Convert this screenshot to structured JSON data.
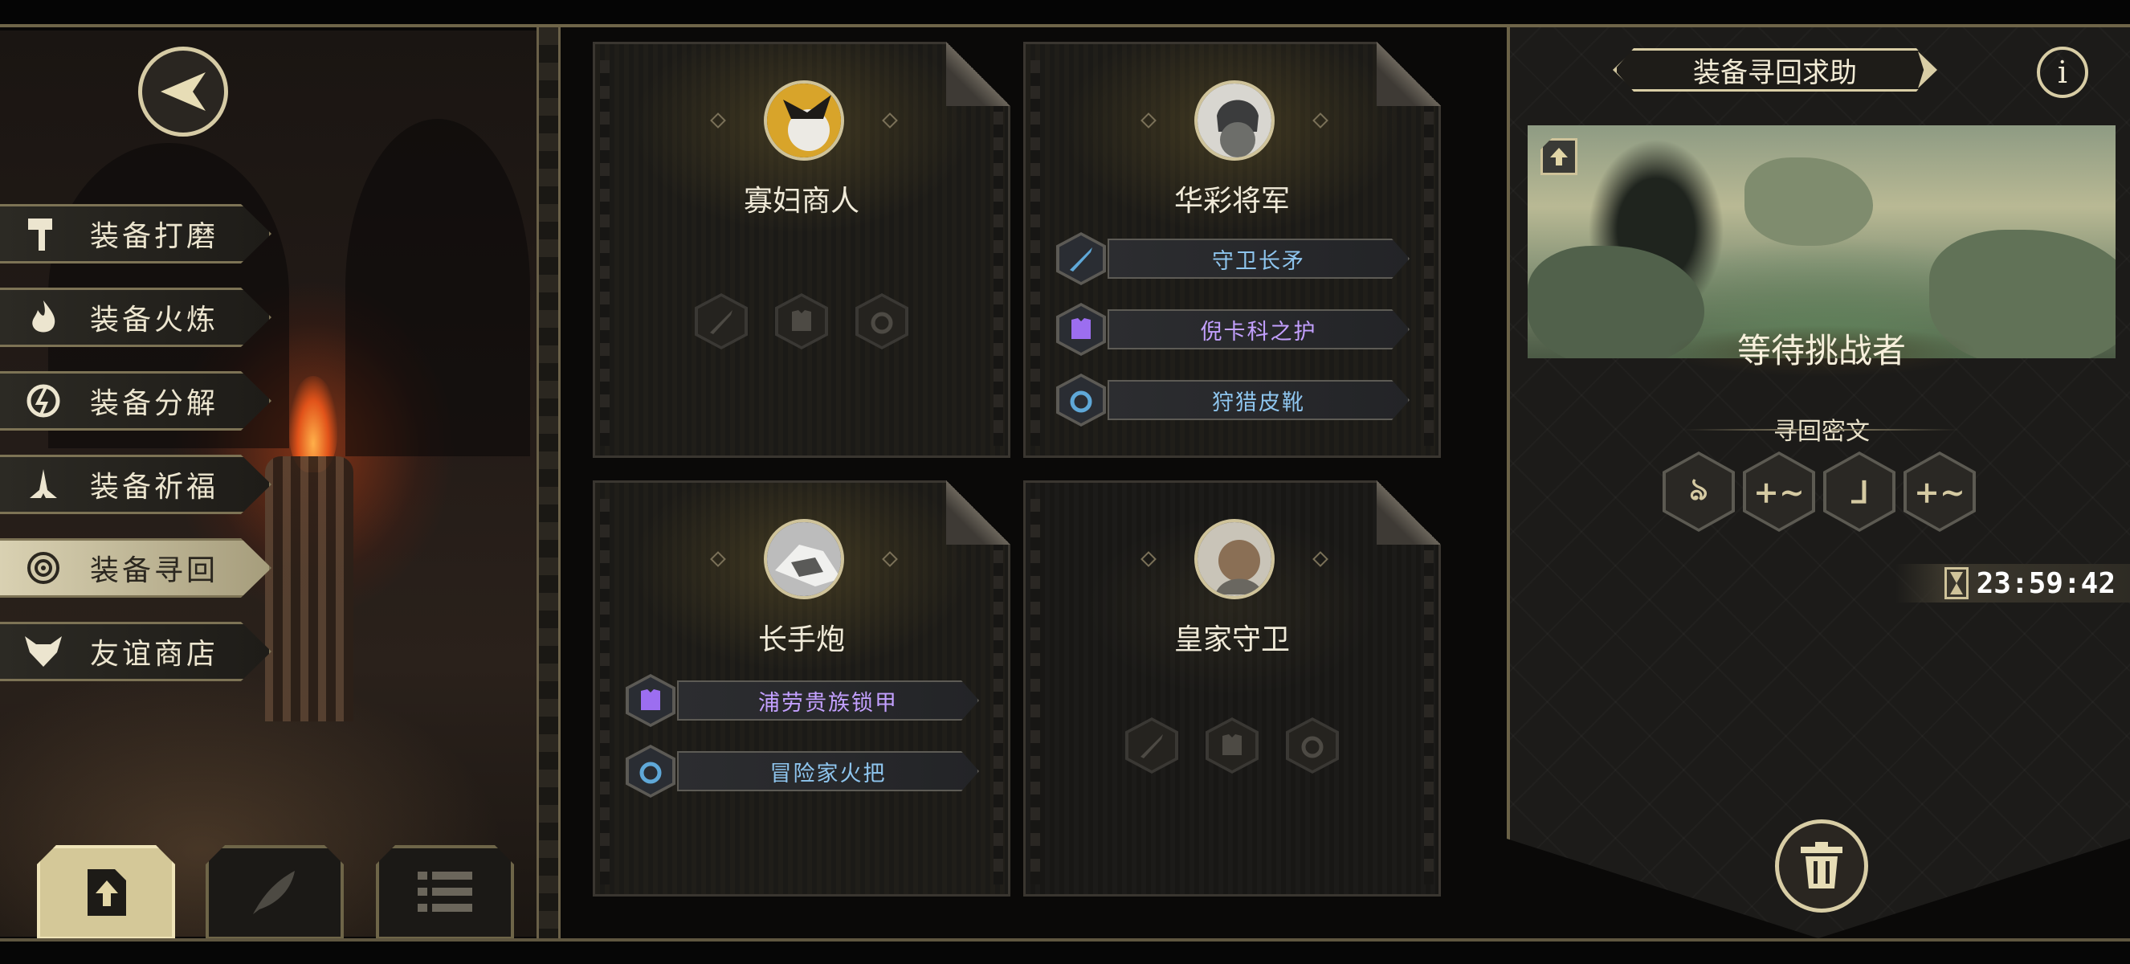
{
  "menu": {
    "items": [
      {
        "label": "装备打磨",
        "icon": "hammer-icon",
        "active": false
      },
      {
        "label": "装备火炼",
        "icon": "flame-icon",
        "active": false
      },
      {
        "label": "装备分解",
        "icon": "disassemble-icon",
        "active": false
      },
      {
        "label": "装备祈福",
        "icon": "pray-hands-icon",
        "active": false
      },
      {
        "label": "装备寻回",
        "icon": "target-icon",
        "active": true
      },
      {
        "label": "友谊商店",
        "icon": "fox-head-icon",
        "active": false
      }
    ]
  },
  "bottom_tabs": [
    {
      "icon": "upload-doc-icon",
      "active": true
    },
    {
      "icon": "feather-icon",
      "active": false
    },
    {
      "icon": "list-icon",
      "active": false
    }
  ],
  "cards": [
    {
      "name": "寡妇商人",
      "portrait": "widow-merchant-portrait",
      "equipment": []
    },
    {
      "name": "华彩将军",
      "portrait": "colorful-general-portrait",
      "equipment": [
        {
          "label": "守卫长矛",
          "icon": "sword-icon",
          "rarity": "blue"
        },
        {
          "label": "倪卡科之护",
          "icon": "armor-icon",
          "rarity": "purple"
        },
        {
          "label": "狩猎皮靴",
          "icon": "ring-icon",
          "rarity": "blue"
        }
      ]
    },
    {
      "name": "长手炮",
      "portrait": "long-cannon-portrait",
      "equipment": [
        {
          "label": "浦劳贵族锁甲",
          "icon": "armor-icon",
          "rarity": "purple"
        },
        {
          "label": "冒险家火把",
          "icon": "ring-icon",
          "rarity": "blue"
        }
      ]
    },
    {
      "name": "皇家守卫",
      "portrait": "royal-guard-portrait",
      "equipment": []
    }
  ],
  "right": {
    "title": "装备寻回求助",
    "info_label": "i",
    "status": "等待挑战者",
    "cipher_label": "寻回密文",
    "runes": [
      "ঌ",
      "+~",
      "ᒧ",
      "+~"
    ],
    "timer": "23:59:42"
  },
  "colors": {
    "accent": "#d8cda5",
    "blue_item": "#8ec5ee",
    "purple_item": "#c3a0ff"
  }
}
